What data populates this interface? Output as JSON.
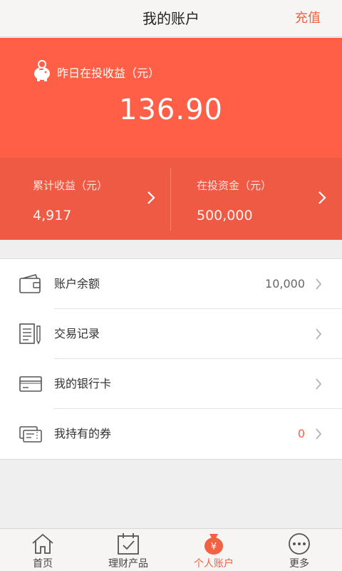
{
  "header": {
    "title": "我的账户",
    "action_label": "充值"
  },
  "summary": {
    "yesterday_label": "昨日在投收益（元）",
    "yesterday_amount": "136.90"
  },
  "stats": [
    {
      "label": "累计收益（元）",
      "value": "4,917"
    },
    {
      "label": "在投资金（元）",
      "value": "500,000"
    }
  ],
  "menu": [
    {
      "label": "账户余额",
      "value": "10,000",
      "icon": "wallet-icon"
    },
    {
      "label": "交易记录",
      "value": "",
      "icon": "document-pen-icon"
    },
    {
      "label": "我的银行卡",
      "value": "",
      "icon": "bank-card-icon"
    },
    {
      "label": "我持有的券",
      "value": "0",
      "icon": "coupon-icon"
    }
  ],
  "tabs": [
    {
      "label": "首页",
      "icon": "home-icon"
    },
    {
      "label": "理财产品",
      "icon": "calendar-check-icon"
    },
    {
      "label": "个人账户",
      "icon": "money-bag-icon",
      "active": true
    },
    {
      "label": "更多",
      "icon": "more-dots-icon"
    }
  ],
  "colors": {
    "accent": "#ff5f47",
    "accent_dark": "#ee5a43",
    "highlight_text": "#f26241"
  }
}
